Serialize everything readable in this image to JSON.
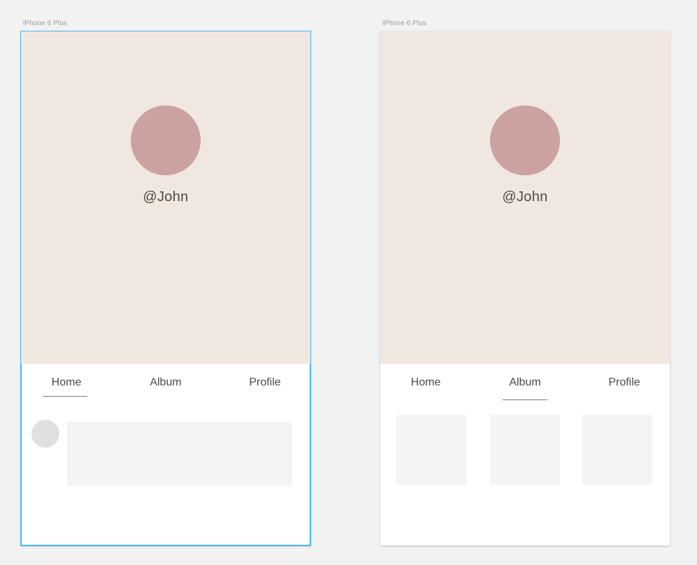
{
  "artboards": [
    {
      "label": "iPhone 6 Plus",
      "username": "@John",
      "tabs": [
        "Home",
        "Album",
        "Profile"
      ],
      "active_tab": "Home"
    },
    {
      "label": "iPhone 6 Plus",
      "username": "@John",
      "tabs": [
        "Home",
        "Album",
        "Profile"
      ],
      "active_tab": "Album"
    }
  ],
  "colors": {
    "canvas_bg": "#f2f2f2",
    "hero_bg": "#f1e7e1",
    "avatar": "#cca2a1",
    "selection": "#4ab8e8",
    "placeholder": "#f4f4f4"
  }
}
